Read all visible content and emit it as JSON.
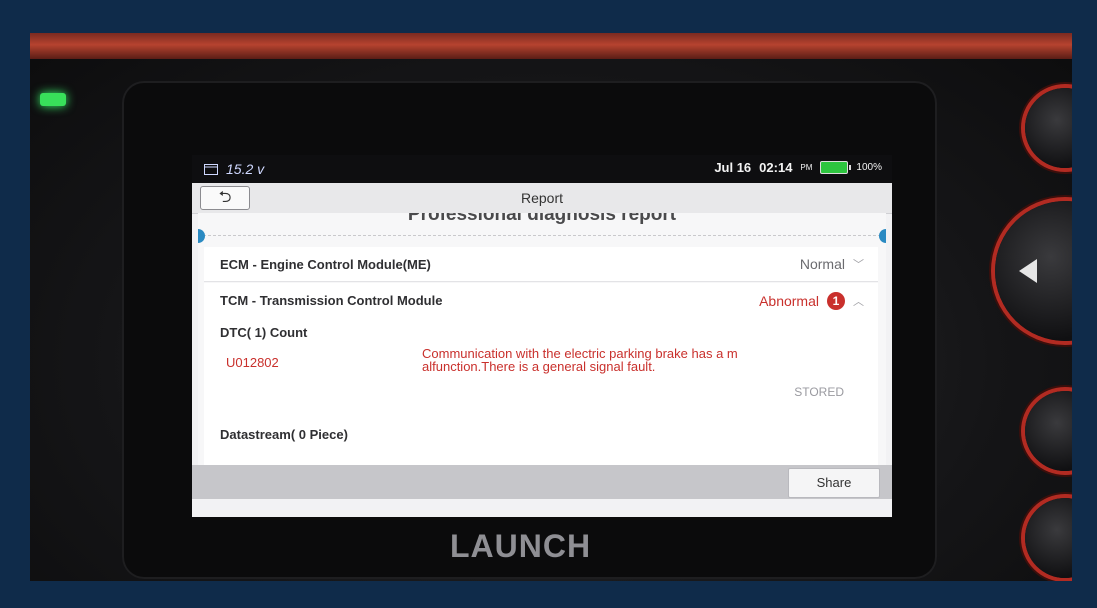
{
  "status_bar": {
    "voltage": "15.2 v",
    "date": "Jul 16",
    "time": "02:14",
    "ampm": "PM",
    "battery": "100%"
  },
  "title_bar": {
    "back_label": "⮌",
    "title": "Report"
  },
  "report": {
    "heading": "Professional diagnosis report",
    "modules": [
      {
        "name": "ECM - Engine Control Module(ME)",
        "status": "Normal"
      },
      {
        "name": "TCM - Transmission Control Module",
        "status": "Abnormal",
        "error_count": "1"
      }
    ],
    "dtc_count_label": "DTC( 1) Count",
    "dtcs": [
      {
        "code": "U012802",
        "description": "Communication with the electric parking brake has a m alfunction.There is a general signal fault.",
        "state": "STORED"
      }
    ],
    "datastream_label": "Datastream( 0 Piece)"
  },
  "bottom_bar": {
    "share_label": "Share"
  },
  "device": {
    "brand": "LAUNCH"
  },
  "colors": {
    "abnormal": "#c9302c",
    "led": "#38e05a",
    "frame": "#0f2b4a"
  }
}
